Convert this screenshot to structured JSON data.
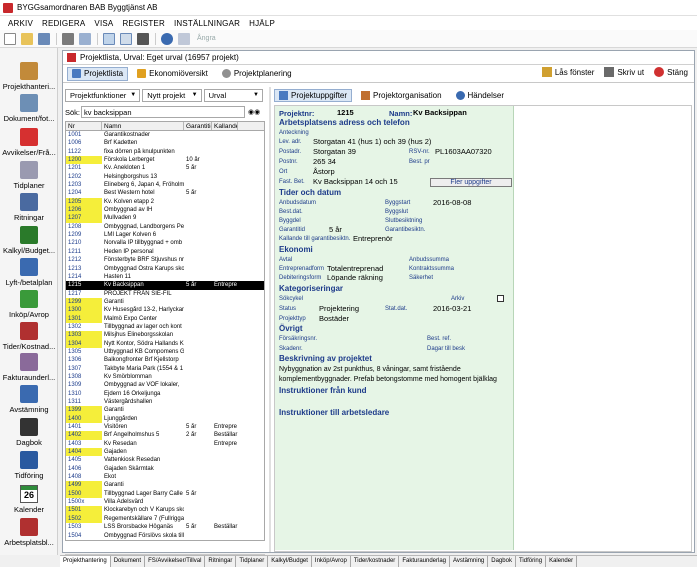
{
  "app": {
    "title": "BYGGsamordnaren BAB Byggtjänst AB"
  },
  "menu": [
    "ARKIV",
    "REDIGERA",
    "VISA",
    "REGISTER",
    "INSTÄLLNINGAR",
    "HJÄLP"
  ],
  "toolbar": {
    "undo_label": "Ångra"
  },
  "sidebar": [
    {
      "label": "Projekthanteri...",
      "icon": "house-icon",
      "color": "#c28a3a"
    },
    {
      "label": "Dokument/fot...",
      "icon": "document-icon",
      "color": "#6d8fb5"
    },
    {
      "label": "Avvikelser/Frå...",
      "icon": "warning-icon",
      "color": "#d63030"
    },
    {
      "label": "Tidplaner",
      "icon": "schedule-icon",
      "color": "#9a9ab0"
    },
    {
      "label": "Ritningar",
      "icon": "drawing-icon",
      "color": "#4a6aa0"
    },
    {
      "label": "Kalkyl/Budget...",
      "icon": "calculator-icon",
      "color": "#2a7a2a"
    },
    {
      "label": "Lyft-/betalplan",
      "icon": "lift-icon",
      "color": "#3a6ab0"
    },
    {
      "label": "Inköp/Avrop",
      "icon": "cart-icon",
      "color": "#3a9a3a"
    },
    {
      "label": "Tider/Kostnad...",
      "icon": "clock-icon",
      "color": "#b03030"
    },
    {
      "label": "Fakturaunderl...",
      "icon": "invoice-icon",
      "color": "#8a6a9a"
    },
    {
      "label": "Avstämning",
      "icon": "checklist-icon",
      "color": "#3a6ab0"
    },
    {
      "label": "Dagbok",
      "icon": "diary-icon",
      "color": "#333333"
    },
    {
      "label": "Tidföring",
      "icon": "timer-icon",
      "color": "#2a5aa0"
    },
    {
      "label": "Kalender",
      "icon": "calendar-icon",
      "color": "#2e8b3a",
      "day": "26"
    },
    {
      "label": "Arbetsplatsbl...",
      "icon": "worksite-icon",
      "color": "#b03030"
    }
  ],
  "window": {
    "title": "Projektlista, Urval: Eget urval (16957 projekt)",
    "tabs": [
      "Projektlista",
      "Ekonomiöversikt",
      "Projektplanering"
    ],
    "actions": [
      "Lås fönster",
      "Skriv ut",
      "Stäng"
    ]
  },
  "list": {
    "filters": {
      "functions": "Projektfunktioner",
      "new": "Nytt projekt",
      "selection": "Urval"
    },
    "search_label": "Sök:",
    "search_value": "kv backsippan",
    "columns": [
      "Nr",
      "Namn",
      "Garantitid",
      "Kallande"
    ],
    "rows": [
      {
        "nr": "1001",
        "name": "Garantikostnader",
        "gar": "",
        "kal": "",
        "y": false
      },
      {
        "nr": "1006",
        "name": "Brf Kadetten",
        "gar": "",
        "kal": "",
        "y": false
      },
      {
        "nr": "1122",
        "name": "fixa dörren på knulpunkten",
        "gar": "",
        "kal": "",
        "y": false
      },
      {
        "nr": "1200",
        "name": "Förskola Lerberget",
        "gar": "10 år",
        "kal": "",
        "y": true
      },
      {
        "nr": "1201",
        "name": "Kv. Anekloten 1",
        "gar": "5 år",
        "kal": "",
        "y": false
      },
      {
        "nr": "1202",
        "name": "Helsingborgshus 13",
        "gar": "",
        "kal": "",
        "y": false
      },
      {
        "nr": "1203",
        "name": "Elineberg 6, Japan 4, Fröholm",
        "gar": "",
        "kal": "",
        "y": false
      },
      {
        "nr": "1204",
        "name": "Best Western hotel",
        "gar": "5 år",
        "kal": "",
        "y": false
      },
      {
        "nr": "1205",
        "name": "Kv. Kolven etapp 2",
        "gar": "",
        "kal": "",
        "y": true
      },
      {
        "nr": "1206",
        "name": "Ombyggnad av IH",
        "gar": "",
        "kal": "",
        "y": true
      },
      {
        "nr": "1207",
        "name": "Mullvaden 9",
        "gar": "",
        "kal": "",
        "y": true
      },
      {
        "nr": "1208",
        "name": "Ombyggnad, Landborgens Pe",
        "gar": "",
        "kal": "",
        "y": false
      },
      {
        "nr": "1209",
        "name": "LMI Lager Kolven 6",
        "gar": "",
        "kal": "",
        "y": false
      },
      {
        "nr": "1210",
        "name": "Norvalla IP tillbyggnad + omb",
        "gar": "",
        "kal": "",
        "y": false
      },
      {
        "nr": "1211",
        "name": "Heden IP personal",
        "gar": "",
        "kal": "",
        "y": false
      },
      {
        "nr": "1212",
        "name": "Fönsterbyte BRF Stjuvshus nr",
        "gar": "",
        "kal": "",
        "y": false
      },
      {
        "nr": "1213",
        "name": "Ombyggnad Östra Karups sko",
        "gar": "",
        "kal": "",
        "y": false
      },
      {
        "nr": "1214",
        "name": "Hasten 11",
        "gar": "",
        "kal": "",
        "y": false
      },
      {
        "nr": "1215",
        "name": "Kv Backsippan",
        "gar": "5 år",
        "kal": "Entrepre",
        "y": false,
        "sel": true
      },
      {
        "nr": "1217",
        "name": "PROJEKT FRÅN SIE-FIL",
        "gar": "",
        "kal": "",
        "y": false
      },
      {
        "nr": "1299",
        "name": "Garanti",
        "gar": "",
        "kal": "",
        "y": true
      },
      {
        "nr": "1300",
        "name": "Kv Husesgård 13-2, Harlyckan",
        "gar": "",
        "kal": "",
        "y": true
      },
      {
        "nr": "1301",
        "name": "Malmö Expo Center",
        "gar": "",
        "kal": "",
        "y": true
      },
      {
        "nr": "1302",
        "name": "Tillbyggnad av lager och kont",
        "gar": "",
        "kal": "",
        "y": false
      },
      {
        "nr": "1303",
        "name": "Milsjhus Elineborgsskolan",
        "gar": "",
        "kal": "",
        "y": true
      },
      {
        "nr": "1304",
        "name": "Nytt Kontor, Södra Hallands K",
        "gar": "",
        "kal": "",
        "y": true
      },
      {
        "nr": "1305",
        "name": "Utbyggnad KB Compomens G",
        "gar": "",
        "kal": "",
        "y": false
      },
      {
        "nr": "1306",
        "name": "Balkongfronter Brf Kjellstorp",
        "gar": "",
        "kal": "",
        "y": false
      },
      {
        "nr": "1307",
        "name": "Takbyte Maria Park (1554 & 1",
        "gar": "",
        "kal": "",
        "y": false
      },
      {
        "nr": "1308",
        "name": "Kv Smörblomman",
        "gar": "",
        "kal": "",
        "y": false
      },
      {
        "nr": "1309",
        "name": "Ombyggnad av VOF lokaler,",
        "gar": "",
        "kal": "",
        "y": false
      },
      {
        "nr": "1310",
        "name": "Ejdern 16 Örkeljunga",
        "gar": "",
        "kal": "",
        "y": false
      },
      {
        "nr": "1311",
        "name": "Västergårdshallen",
        "gar": "",
        "kal": "",
        "y": false
      },
      {
        "nr": "1399",
        "name": "Garanti",
        "gar": "",
        "kal": "",
        "y": true
      },
      {
        "nr": "1400",
        "name": "Ljunggården",
        "gar": "",
        "kal": "",
        "y": true
      },
      {
        "nr": "1401",
        "name": "Visitören",
        "gar": "5 år",
        "kal": "Entrepre",
        "y": false
      },
      {
        "nr": "1402",
        "name": "Brf Ängelholmshus 5",
        "gar": "2 år",
        "kal": "Beställar",
        "y": true
      },
      {
        "nr": "1403",
        "name": "Kv Resedan",
        "gar": "",
        "kal": "Entrepre",
        "y": false
      },
      {
        "nr": "1404",
        "name": "Gajaden",
        "gar": "",
        "kal": "",
        "y": true
      },
      {
        "nr": "1405",
        "name": "Vattenkiosk Resedan",
        "gar": "",
        "kal": "",
        "y": false
      },
      {
        "nr": "1406",
        "name": "Gajaden Skärmtak",
        "gar": "",
        "kal": "",
        "y": false
      },
      {
        "nr": "1408",
        "name": "Ekot",
        "gar": "",
        "kal": "",
        "y": false
      },
      {
        "nr": "1499",
        "name": "Garanti",
        "gar": "",
        "kal": "",
        "y": true
      },
      {
        "nr": "1500",
        "name": "Tillbyggnad Lager Barry Calle",
        "gar": "5 år",
        "kal": "",
        "y": true
      },
      {
        "nr": "1500x",
        "name": "Villa Adelsvärd",
        "gar": "",
        "kal": "",
        "y": false
      },
      {
        "nr": "1501",
        "name": "Klockarebyn och V Karups skol",
        "gar": "",
        "kal": "",
        "y": true
      },
      {
        "nr": "1502",
        "name": "Regementskällare 7 (Fullriggar",
        "gar": "",
        "kal": "",
        "y": true
      },
      {
        "nr": "1503",
        "name": "LSS Brorsbacke Höganäs",
        "gar": "5 år",
        "kal": "Beställar",
        "y": false
      },
      {
        "nr": "1504",
        "name": "Ombyggnad Förslövs skola till",
        "gar": "",
        "kal": "",
        "y": false
      }
    ]
  },
  "detail": {
    "tabs": [
      "Projektuppgifter",
      "Projektorganisation",
      "Händelser"
    ],
    "project_no_label": "Projektnr:",
    "project_no": "1215",
    "name_label": "Namn:",
    "name": "Kv Backsippan",
    "sections": {
      "address": "Arbetsplatsens adress och telefon",
      "time": "Tider och datum",
      "economy": "Ekonomi",
      "category": "Kategoriseringar",
      "other": "Övrigt",
      "description": "Beskrivning av projektet",
      "instr_customer": "Instruktioner från kund",
      "instr_site": "Instruktioner till arbetsledare"
    },
    "labels": {
      "anteckning": "Anteckning",
      "levadr": "Lev. adr.",
      "postadr": "Postadr.",
      "postnr": "Postnr.",
      "ort": "Ort",
      "fastbet": "Fast. Bet.",
      "rsv": "RSV-nr.",
      "bestpr": "Best. pr",
      "anbud": "Anbudsdatum",
      "bestdat": "Best.dat.",
      "byggdel": "Byggdel",
      "garanti": "Garantitid",
      "kallande": "Kallande till garantibesiktn.",
      "byggstart": "Byggstart",
      "byggslut": "Byggslut",
      "slutbes": "Slutbesiktning",
      "garbes": "Garantibesiktn.",
      "avtal": "Avtal",
      "entform": "Entreprenadform",
      "debform": "Debiteringsform",
      "anbsum": "Anbudssumma",
      "kontsum": "Kontraktssumma",
      "sakerhet": "Säkerhet",
      "sokcykel": "Sökcykel",
      "status": "Status",
      "projtyp": "Projekttyp",
      "arkiv": "Arkiv",
      "statdat": "Stat.dat.",
      "forsak": "Försäkringsnr.",
      "skade": "Skadenr.",
      "bestref": "Best. ref.",
      "dagar": "Dagar till besk"
    },
    "values": {
      "levadr": "Storgatan 41 (hus 1) och 39 (hus 2)",
      "postadr": "Storgatan 39",
      "postnr": "265 34",
      "ort": "Åstorp",
      "fastbet": "Kv Backsippan 14 och 15",
      "rsv": "PL1603AA07320",
      "byggstart": "2016-08-08",
      "garanti": "5 år",
      "kallande": "Entreprenör",
      "entform": "Totalentreprenad",
      "debform": "Löpande räkning",
      "status": "Projektering",
      "statdat": "2016-03-21",
      "projtyp": "Bostäder"
    },
    "more_button": "Fler uppgifter",
    "description_lines": [
      "Nybyggnation av 2st punkthus, 8 våningar, samt fristående",
      "komplementbyggnader. Prefab betongstomme med homogent bjälklag"
    ]
  },
  "bottom_tabs": [
    "Projekthantering",
    "Dokument",
    "FS/Avvikelser/Tillval",
    "Ritningar",
    "Tidplaner",
    "Kalkyl/Budget",
    "Inköp/Avrop",
    "Tider/kostnader",
    "Fakturaunderlag",
    "Avstämning",
    "Dagbok",
    "Tidföring",
    "Kalender"
  ],
  "colors": {
    "accent": "#1d3b8a",
    "form_bg": "#e6f5e6",
    "highlight": "#f5ee3a",
    "selection": "#000000"
  }
}
